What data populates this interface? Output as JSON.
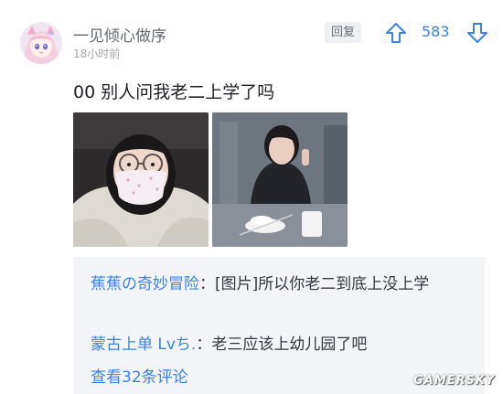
{
  "post": {
    "author": "一见倾心做序",
    "time": "18小时前",
    "reply_label": "回复",
    "vote_count": "583",
    "text": "00 别人问我老二上学了吗",
    "images": [
      {
        "alt": "image-1"
      },
      {
        "alt": "image-2"
      }
    ]
  },
  "comments": [
    {
      "author": "蕉蕉の奇妙冒险",
      "separator": "：",
      "text": "[图片]所以你老二到底上没上学"
    },
    {
      "author": "蒙古上单 Lvち.",
      "separator": "：",
      "text": "老三应该上幼儿园了吧"
    }
  ],
  "view_all_label": "查看32条评论",
  "watermark": "GAMERSKY",
  "colors": {
    "accent": "#3c82e4",
    "text": "#1e2026",
    "muted": "#a3a6ab",
    "comment_bg": "#f2f4f7"
  },
  "icons": [
    "avatar",
    "arrow-up-icon",
    "arrow-down-icon"
  ]
}
